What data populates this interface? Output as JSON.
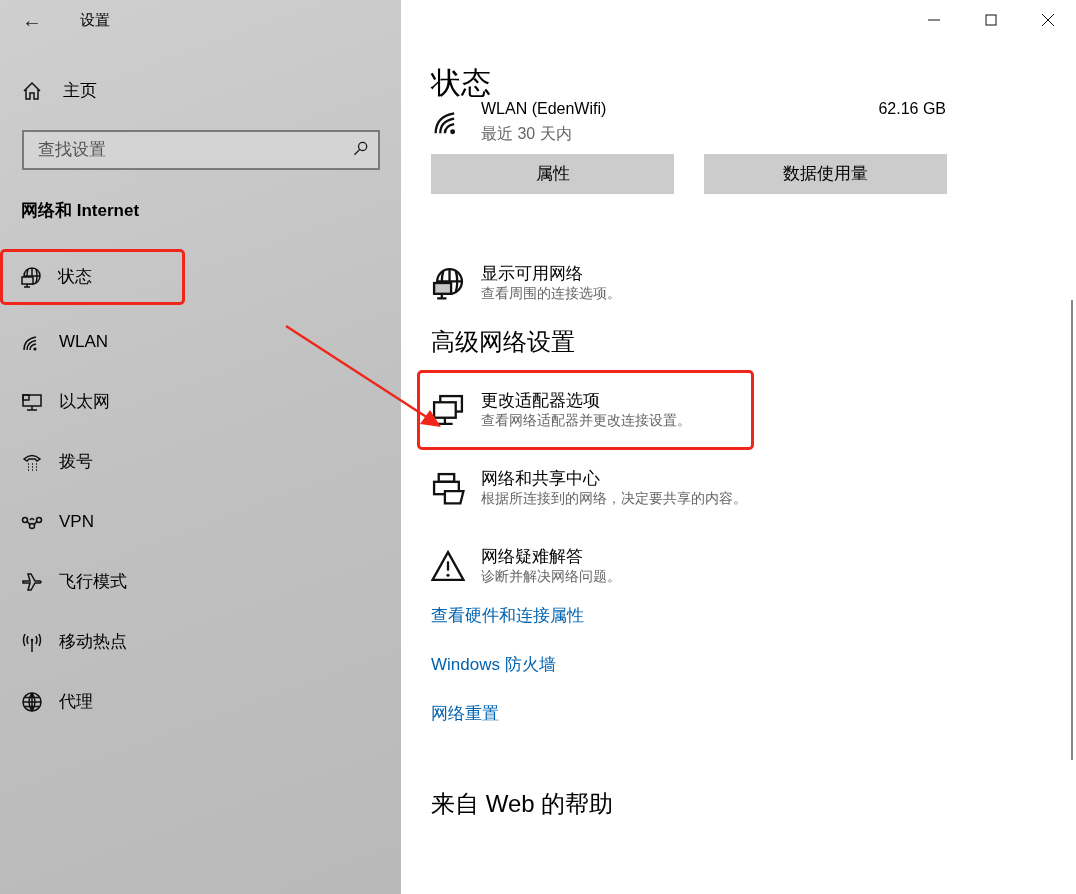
{
  "window": {
    "title": "设置",
    "back": "←"
  },
  "sidebar": {
    "home": "主页",
    "search": {
      "placeholder": "查找设置"
    },
    "section": "网络和 Internet",
    "items": [
      {
        "label": "状态",
        "highlighted": true
      },
      {
        "label": "WLAN",
        "highlighted": false
      },
      {
        "label": "以太网",
        "highlighted": false
      },
      {
        "label": "拨号",
        "highlighted": false
      },
      {
        "label": "VPN",
        "highlighted": false
      },
      {
        "label": "飞行模式",
        "highlighted": false
      },
      {
        "label": "移动热点",
        "highlighted": false
      },
      {
        "label": "代理",
        "highlighted": false
      }
    ]
  },
  "main": {
    "title": "状态",
    "usage": {
      "network": "WLAN (EdenWifi)",
      "period": "最近 30 天内",
      "amount": "62.16 GB"
    },
    "buttons": [
      "属性",
      "数据使用量"
    ],
    "show_networks": {
      "title": "显示可用网络",
      "subtitle": "查看周围的连接选项。"
    },
    "advanced_heading": "高级网络设置",
    "options": [
      {
        "title": "更改适配器选项",
        "subtitle": "查看网络适配器并更改连接设置。",
        "highlighted": true
      },
      {
        "title": "网络和共享中心",
        "subtitle": "根据所连接到的网络，决定要共享的内容。",
        "highlighted": false
      },
      {
        "title": "网络疑难解答",
        "subtitle": "诊断并解决网络问题。",
        "highlighted": false
      }
    ],
    "links": [
      "查看硬件和连接属性",
      "Windows 防火墙",
      "网络重置"
    ],
    "help_heading": "来自 Web 的帮助"
  }
}
